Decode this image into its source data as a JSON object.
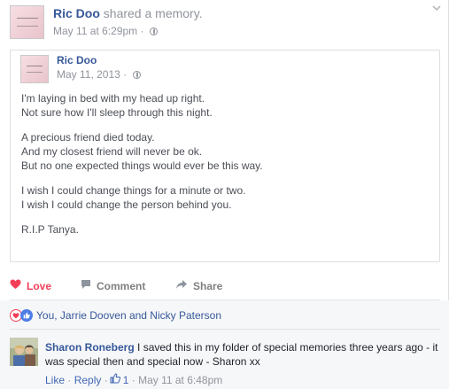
{
  "post": {
    "author": "Ric Doo",
    "action": "shared a memory.",
    "timestamp": "May 11 at 6:29pm",
    "privacy_icon": "globe-icon"
  },
  "memory": {
    "author": "Ric Doo",
    "timestamp": "May 11, 2013",
    "stanzas": [
      [
        "I'm laying in bed with my head up right.",
        "Not sure how I'll sleep through this night."
      ],
      [
        "A precious friend died today.",
        "And my closest friend will never be ok.",
        "But no one expected things would ever be this way."
      ],
      [
        "I wish I could change things for a minute or two.",
        "I wish I could change the person behind you."
      ],
      [
        "R.I.P Tanya."
      ]
    ]
  },
  "actions": {
    "love_label": "Love",
    "comment_label": "Comment",
    "share_label": "Share"
  },
  "reactions": {
    "summary": "You, Jarrie Dooven and Nicky Paterson"
  },
  "comment": {
    "author": "Sharon Roneberg",
    "text": "I saved this in my folder of special memories three years ago - it was special then and special now - Sharon xx",
    "like_label": "Like",
    "reply_label": "Reply",
    "like_count": "1",
    "timestamp": "May 11 at 6:48pm"
  },
  "colors": {
    "link": "#365899",
    "love": "#f33e58",
    "muted": "#90949c"
  }
}
